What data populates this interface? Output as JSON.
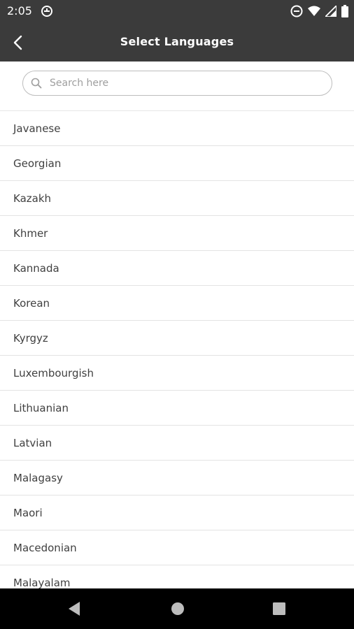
{
  "status_bar": {
    "time": "2:05",
    "left_icon": "do-not-disturb-app-icon",
    "right_icons": [
      "dnd-circle-icon",
      "wifi-icon",
      "signal-icon",
      "battery-icon"
    ]
  },
  "app_bar": {
    "back_icon": "chevron-left-icon",
    "title": "Select Languages",
    "background": "#3b3b3b"
  },
  "search": {
    "placeholder": "Search here",
    "value": ""
  },
  "languages": [
    "Javanese",
    "Georgian",
    "Kazakh",
    "Khmer",
    "Kannada",
    "Korean",
    "Kyrgyz",
    "Luxembourgish",
    "Lithuanian",
    "Latvian",
    "Malagasy",
    "Maori",
    "Macedonian",
    "Malayalam"
  ],
  "nav_bar": {
    "icons": [
      "back-triangle-icon",
      "home-circle-icon",
      "recents-square-icon"
    ]
  }
}
